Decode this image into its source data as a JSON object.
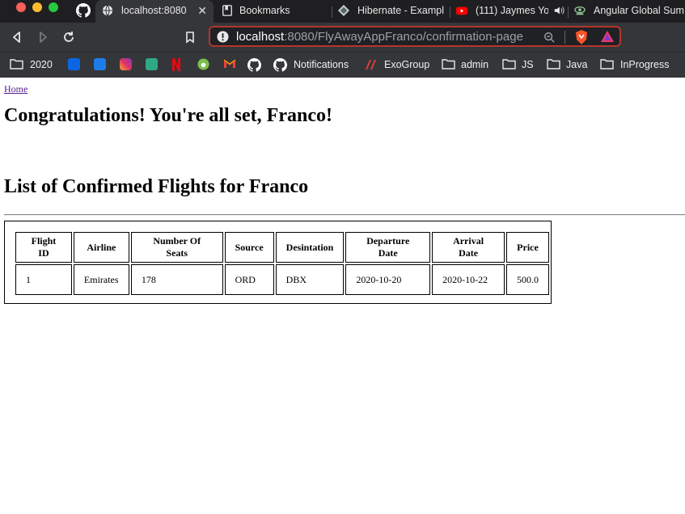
{
  "browser": {
    "tabs": [
      {
        "title": "localhost:8080",
        "active": true
      },
      {
        "title": "Bookmarks"
      },
      {
        "title": "Hibernate - Exampl"
      },
      {
        "title": "(111) Jaymes Yo"
      },
      {
        "title": "Angular Global Sum"
      }
    ],
    "url_host": "localhost",
    "url_path": ":8080/FlyAwayAppFranco/confirmation-page",
    "bookmarks": [
      "2020",
      "Notifications",
      "ExoGroup",
      "admin",
      "JS",
      "Java",
      "InProgress"
    ]
  },
  "page": {
    "home_link": "Home",
    "heading": "Congratulations! You're all set, Franco!",
    "subheading": "List of Confirmed Flights for Franco",
    "table": {
      "columns": [
        "Flight ID",
        "Airline",
        "Number Of Seats",
        "Source",
        "Desintation",
        "Departure Date",
        "Arrival Date",
        "Price"
      ],
      "rows": [
        [
          "1",
          "Emirates",
          "178",
          "ORD",
          "DBX",
          "2020-10-20",
          "2020-10-22",
          "500.0"
        ]
      ]
    }
  },
  "colors": {
    "chrome_bg": "#35363a",
    "tabbar_bg": "#1f1f22",
    "url_border": "#b3362c",
    "link_visited": "#551a8b"
  }
}
